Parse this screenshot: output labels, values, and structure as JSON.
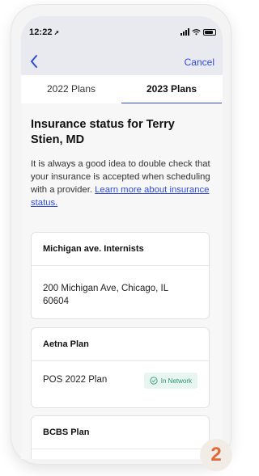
{
  "status_bar": {
    "time": "12:22",
    "location_arrow": "➚"
  },
  "nav": {
    "cancel_label": "Cancel"
  },
  "tabs": [
    {
      "label": "2022 Plans"
    },
    {
      "label": "2023 Plans"
    }
  ],
  "content": {
    "heading": "Insurance status for Terry Stien, MD",
    "description": "It is always a good idea to double check that your insurance is accepted when scheduling with a provider.",
    "learn_more_link": "Learn more about insurance status."
  },
  "cards": [
    {
      "title": "Michigan ave. Internists",
      "address": "200 Michigan Ave, Chicago, IL 60604"
    },
    {
      "title": "Aetna Plan",
      "plan_name": "POS 2022 Plan",
      "badge": "In Network"
    },
    {
      "title": "BCBS Plan"
    }
  ],
  "corner_badge": {
    "number": "2"
  },
  "colors": {
    "accent": "#2f4bd6",
    "badge_green": "#2f8f73",
    "orange": "#e0693b"
  }
}
